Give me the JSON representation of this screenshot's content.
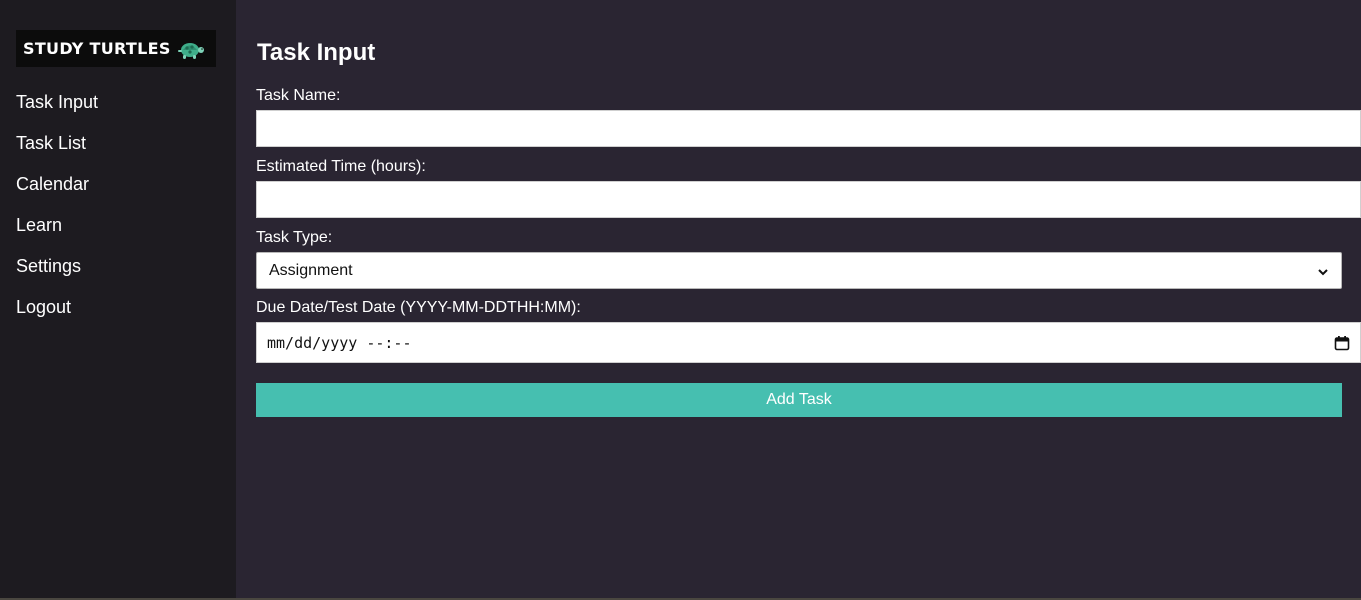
{
  "app": {
    "logo_text": "STUDY TURTLES",
    "logo_icon": "turtle-icon",
    "accent_color": "#46bfb0"
  },
  "sidebar": {
    "items": [
      {
        "label": "Task Input"
      },
      {
        "label": "Task List"
      },
      {
        "label": "Calendar"
      },
      {
        "label": "Learn"
      },
      {
        "label": "Settings"
      },
      {
        "label": "Logout"
      }
    ]
  },
  "main": {
    "title": "Task Input",
    "task_name": {
      "label": "Task Name:",
      "value": ""
    },
    "estimated_time": {
      "label": "Estimated Time (hours):",
      "value": ""
    },
    "task_type": {
      "label": "Task Type:",
      "selected": "Assignment",
      "icon": "chevron-down-icon"
    },
    "due_date": {
      "label": "Due Date/Test Date (YYYY-MM-DDTHH:MM):",
      "placeholder": "mm/dd/yyyy --:--",
      "icon": "calendar-icon"
    },
    "submit_label": "Add Task"
  }
}
